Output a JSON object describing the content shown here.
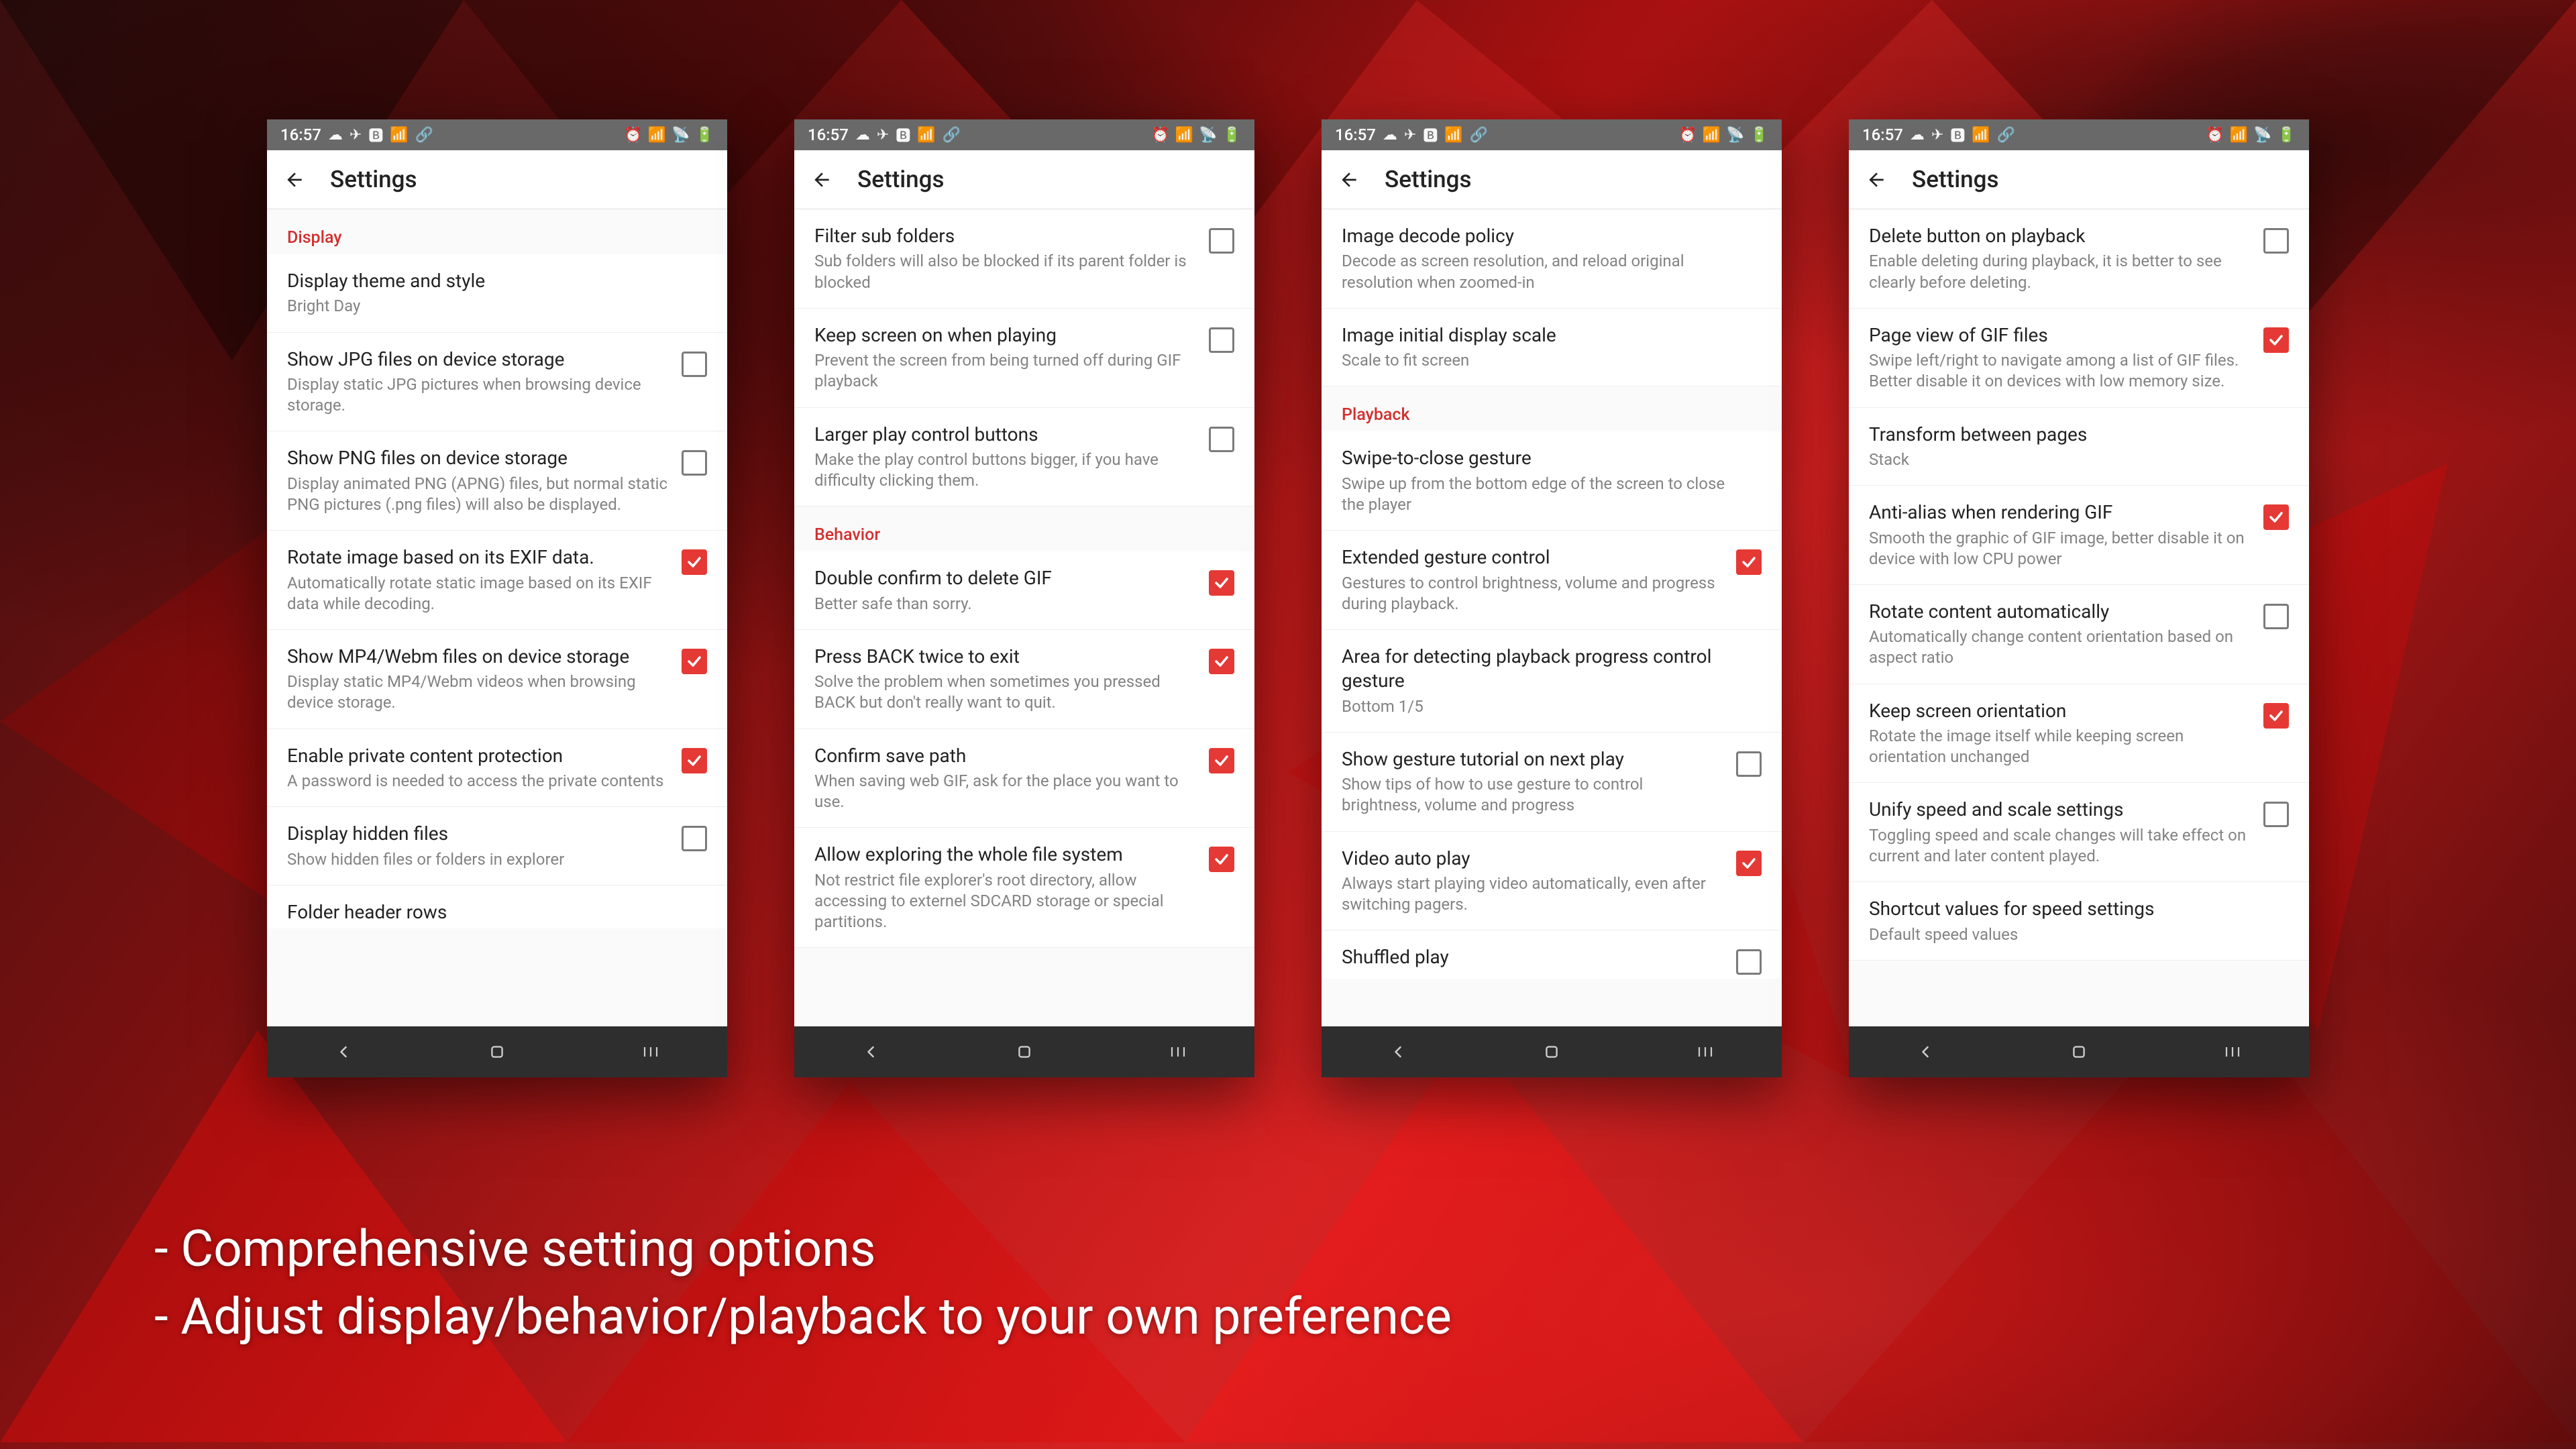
{
  "status": {
    "time": "16:57",
    "left_icons": [
      "☁",
      "✈",
      "🅱",
      "📶",
      "🔗"
    ],
    "right_icons": [
      "⏰",
      "📶",
      "📡",
      "🔋"
    ]
  },
  "app_title": "Settings",
  "caption_line1": "- Comprehensive setting options",
  "caption_line2": "- Adjust display/behavior/playback to your own preference",
  "screens": [
    {
      "rows": [
        {
          "type": "header",
          "label": "Display"
        },
        {
          "type": "item",
          "title": "Display theme and style",
          "sub": "Bright Day"
        },
        {
          "type": "check",
          "title": "Show JPG files on device storage",
          "sub": "Display static JPG pictures when browsing device storage.",
          "checked": false
        },
        {
          "type": "check",
          "title": "Show PNG files on device storage",
          "sub": "Display animated PNG (APNG) files, but normal static PNG pictures (.png files) will also be displayed.",
          "checked": false
        },
        {
          "type": "check",
          "title": "Rotate image based on its EXIF data.",
          "sub": "Automatically rotate static image based on its EXIF data while decoding.",
          "checked": true
        },
        {
          "type": "check",
          "title": "Show MP4/Webm files on device storage",
          "sub": "Display static MP4/Webm videos when browsing device storage.",
          "checked": true
        },
        {
          "type": "check",
          "title": "Enable private content protection",
          "sub": "A password is needed to access the private contents",
          "checked": true
        },
        {
          "type": "check",
          "title": "Display hidden files",
          "sub": "Show hidden files or folders in explorer",
          "checked": false
        },
        {
          "type": "partial",
          "title": "Folder header rows",
          "sub": ""
        }
      ]
    },
    {
      "rows": [
        {
          "type": "check",
          "title": "Filter sub folders",
          "sub": "Sub folders will also be blocked if its parent folder is blocked",
          "checked": false
        },
        {
          "type": "check",
          "title": "Keep screen on when playing",
          "sub": "Prevent the screen from being turned off during GIF playback",
          "checked": false
        },
        {
          "type": "check",
          "title": "Larger play control buttons",
          "sub": "Make the play control buttons bigger, if you have difficulty clicking them.",
          "checked": false
        },
        {
          "type": "header",
          "label": "Behavior"
        },
        {
          "type": "check",
          "title": "Double confirm to delete GIF",
          "sub": "Better safe than sorry.",
          "checked": true
        },
        {
          "type": "check",
          "title": "Press BACK twice to exit",
          "sub": "Solve the problem when sometimes you pressed BACK but don't really want to quit.",
          "checked": true
        },
        {
          "type": "check",
          "title": "Confirm save path",
          "sub": "When saving web GIF, ask for the place you want to use.",
          "checked": true
        },
        {
          "type": "check",
          "title": "Allow exploring the whole file system",
          "sub": "Not restrict file explorer's root directory, allow accessing to externel SDCARD storage or special partitions.",
          "checked": true
        }
      ]
    },
    {
      "rows": [
        {
          "type": "item",
          "title": "Image decode policy",
          "sub": "Decode as screen resolution, and reload original resolution when zoomed-in"
        },
        {
          "type": "item",
          "title": "Image initial display scale",
          "sub": "Scale to fit screen"
        },
        {
          "type": "header",
          "label": "Playback"
        },
        {
          "type": "item",
          "title": "Swipe-to-close gesture",
          "sub": "Swipe up from the bottom edge of the screen to close the player"
        },
        {
          "type": "check",
          "title": "Extended gesture control",
          "sub": "Gestures to control brightness, volume and progress during playback.",
          "checked": true
        },
        {
          "type": "item",
          "title": "Area for detecting playback progress control gesture",
          "sub": "Bottom 1/5"
        },
        {
          "type": "check",
          "title": "Show gesture tutorial on next play",
          "sub": "Show tips of how to use gesture to control brightness, volume and progress",
          "checked": false
        },
        {
          "type": "check",
          "title": "Video auto play",
          "sub": "Always start playing video automatically, even after switching pagers.",
          "checked": true
        },
        {
          "type": "partial-check",
          "title": "Shuffled play",
          "sub": "",
          "checked": false
        }
      ]
    },
    {
      "rows": [
        {
          "type": "check",
          "title": "Delete button on playback",
          "sub": "Enable deleting during playback, it is better to see clearly before deleting.",
          "checked": false
        },
        {
          "type": "check",
          "title": "Page view of GIF files",
          "sub": "Swipe left/right to navigate among a list of GIF files. Better disable it on devices with low memory size.",
          "checked": true
        },
        {
          "type": "item",
          "title": "Transform between pages",
          "sub": "Stack"
        },
        {
          "type": "check",
          "title": "Anti-alias when rendering GIF",
          "sub": "Smooth the graphic of GIF image, better disable it on device with low CPU power",
          "checked": true
        },
        {
          "type": "check",
          "title": "Rotate content automatically",
          "sub": "Automatically change content orientation based on aspect ratio",
          "checked": false
        },
        {
          "type": "check",
          "title": "Keep screen orientation",
          "sub": "Rotate the image itself while keeping screen orientation unchanged",
          "checked": true
        },
        {
          "type": "check",
          "title": "Unify speed and scale settings",
          "sub": "Toggling speed and scale changes will take effect on current and later content played.",
          "checked": false
        },
        {
          "type": "item",
          "title": "Shortcut values for speed settings",
          "sub": "Default speed values"
        }
      ]
    }
  ]
}
